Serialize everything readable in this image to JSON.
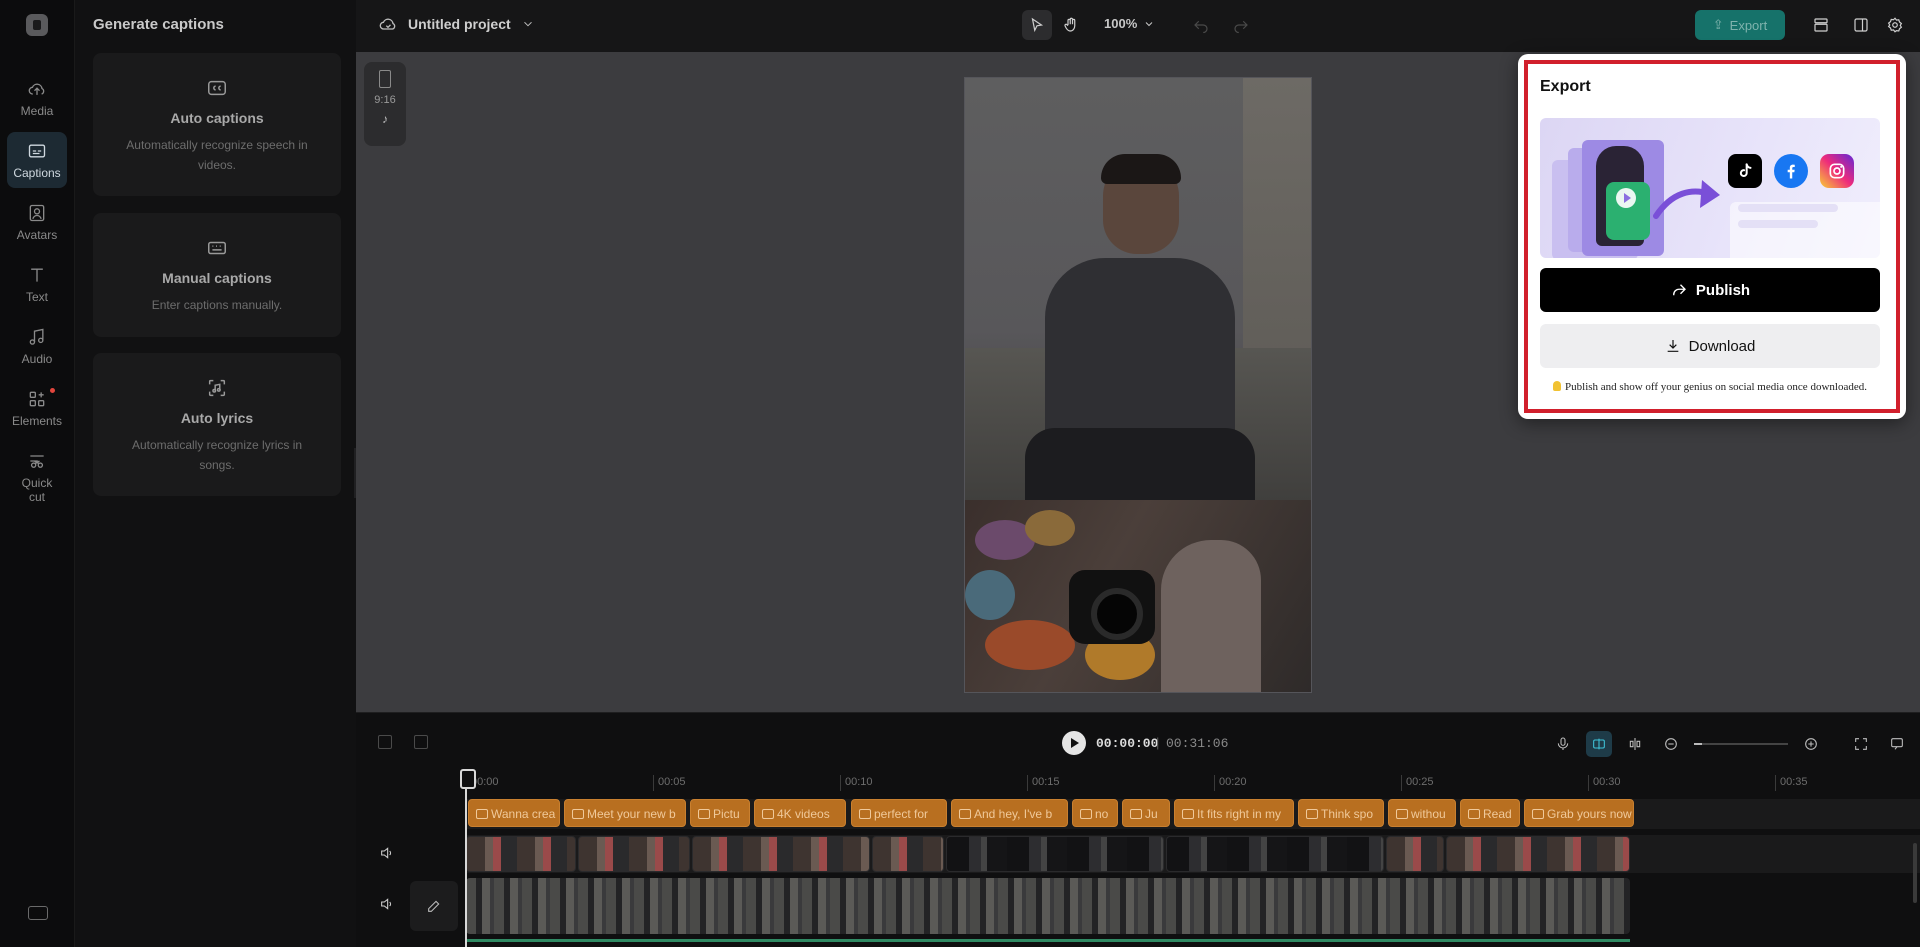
{
  "rail": {
    "items": [
      {
        "label": "Media",
        "icon": "cloud-upload-icon"
      },
      {
        "label": "Captions",
        "icon": "captions-icon",
        "active": true
      },
      {
        "label": "Avatars",
        "icon": "avatar-icon"
      },
      {
        "label": "Text",
        "icon": "text-icon"
      },
      {
        "label": "Audio",
        "icon": "music-icon"
      },
      {
        "label": "Elements",
        "icon": "elements-icon"
      },
      {
        "label": "Quick",
        "label2": "cut",
        "icon": "quick-cut-icon"
      }
    ]
  },
  "panel": {
    "title": "Generate captions",
    "cards": [
      {
        "title": "Auto captions",
        "desc": "Automatically recognize speech in videos.",
        "icon": "cc-icon"
      },
      {
        "title": "Manual captions",
        "desc": "Enter captions manually.",
        "icon": "keyboard-icon"
      },
      {
        "title": "Auto lyrics",
        "desc": "Automatically recognize lyrics in songs.",
        "icon": "lyrics-icon"
      }
    ]
  },
  "topbar": {
    "project_name": "Untitled project",
    "zoom": "100%",
    "export_label": "Export"
  },
  "stage": {
    "ratio": "9:16"
  },
  "timeline": {
    "current_time": "00:00:00",
    "total_time": "00:31:06",
    "ruler": [
      "00:00",
      "00:05",
      "00:10",
      "00:15",
      "00:20",
      "00:25",
      "00:30",
      "00:35"
    ],
    "captions": [
      "Wanna crea",
      "Meet your new b",
      "Pictu",
      "4K videos",
      "perfect for",
      "And hey, I've b",
      "no",
      "Ju",
      "It fits right in my",
      "Think spo",
      "withou",
      "Read",
      "Grab yours now"
    ]
  },
  "export_popover": {
    "title": "Export",
    "publish_label": "Publish",
    "download_label": "Download",
    "tip": "Publish and show off your genius on social media once downloaded.",
    "socials": [
      "tiktok-icon",
      "facebook-icon",
      "instagram-icon"
    ],
    "highlight_color": "#d11f2c"
  }
}
